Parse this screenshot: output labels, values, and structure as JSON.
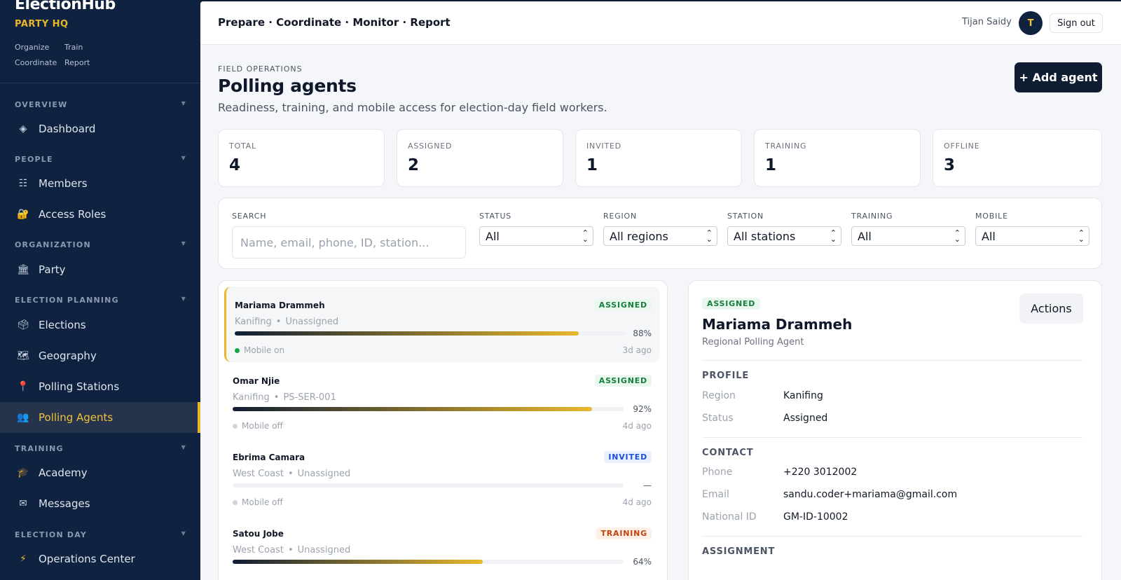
{
  "brand": {
    "name": "ElectionHub",
    "subtitle": "PARTY HQ",
    "tags": [
      "Organize",
      "Train",
      "Coordinate",
      "Report"
    ]
  },
  "sidebar": {
    "sections": [
      {
        "title": "OVERVIEW",
        "items": [
          {
            "label": "Dashboard",
            "icon": "diamond-icon"
          }
        ]
      },
      {
        "title": "PEOPLE",
        "items": [
          {
            "label": "Members",
            "icon": "list-icon"
          },
          {
            "label": "Access Roles",
            "icon": "lock-key-icon"
          }
        ]
      },
      {
        "title": "ORGANIZATION",
        "items": [
          {
            "label": "Party",
            "icon": "building-icon"
          }
        ]
      },
      {
        "title": "ELECTION PLANNING",
        "items": [
          {
            "label": "Elections",
            "icon": "ballot-box-icon"
          },
          {
            "label": "Geography",
            "icon": "map-icon"
          },
          {
            "label": "Polling Stations",
            "icon": "pin-icon"
          },
          {
            "label": "Polling Agents",
            "icon": "people-icon",
            "active": true
          }
        ]
      },
      {
        "title": "TRAINING",
        "items": [
          {
            "label": "Academy",
            "icon": "graduation-cap-icon"
          },
          {
            "label": "Messages",
            "icon": "envelope-icon"
          }
        ]
      },
      {
        "title": "ELECTION DAY",
        "items": [
          {
            "label": "Operations Center",
            "icon": "lightning-icon"
          }
        ]
      }
    ]
  },
  "topbar": {
    "tagline": "Prepare · Coordinate · Monitor · Report",
    "user_name": "Tijan Saidy",
    "avatar_initial": "T",
    "sign_out": "Sign out"
  },
  "page": {
    "eyebrow": "FIELD OPERATIONS",
    "title": "Polling agents",
    "subtitle": "Readiness, training, and mobile access for election-day field workers.",
    "add_button": "+ Add agent"
  },
  "stats": [
    {
      "label": "TOTAL",
      "value": "4"
    },
    {
      "label": "ASSIGNED",
      "value": "2"
    },
    {
      "label": "INVITED",
      "value": "1"
    },
    {
      "label": "TRAINING",
      "value": "1"
    },
    {
      "label": "OFFLINE",
      "value": "3"
    }
  ],
  "filters": {
    "search_label": "SEARCH",
    "search_placeholder": "Name, email, phone, ID, station...",
    "selects": [
      {
        "label": "STATUS",
        "value": "All"
      },
      {
        "label": "REGION",
        "value": "All regions"
      },
      {
        "label": "STATION",
        "value": "All stations"
      },
      {
        "label": "TRAINING",
        "value": "All"
      },
      {
        "label": "MOBILE",
        "value": "All"
      }
    ]
  },
  "agents": [
    {
      "name": "Mariama Drammeh",
      "status": "ASSIGNED",
      "region": "Kanifing",
      "station": "Unassigned",
      "progress": 88,
      "progress_label": "88%",
      "mobile": "Mobile on",
      "mobile_color": "#16a34a",
      "last_seen": "3d ago",
      "selected": true
    },
    {
      "name": "Omar Njie",
      "status": "ASSIGNED",
      "region": "Kanifing",
      "station": "PS-SER-001",
      "progress": 92,
      "progress_label": "92%",
      "mobile": "Mobile off",
      "mobile_color": "#cfd3da",
      "last_seen": "4d ago"
    },
    {
      "name": "Ebrima Camara",
      "status": "INVITED",
      "region": "West Coast",
      "station": "Unassigned",
      "progress": 0,
      "progress_label": "—",
      "mobile": "Mobile off",
      "mobile_color": "#cfd3da",
      "last_seen": "4d ago"
    },
    {
      "name": "Satou Jobe",
      "status": "TRAINING",
      "region": "West Coast",
      "station": "Unassigned",
      "progress": 64,
      "progress_label": "64%",
      "mobile": "Mobile off",
      "mobile_color": "#cfd3da",
      "last_seen": ""
    }
  ],
  "detail": {
    "status": "ASSIGNED",
    "name": "Mariama Drammeh",
    "role": "Regional Polling Agent",
    "actions": "Actions",
    "profile_title": "PROFILE",
    "profile": [
      {
        "key": "Region",
        "value": "Kanifing"
      },
      {
        "key": "Status",
        "value": "Assigned"
      }
    ],
    "contact_title": "CONTACT",
    "contact": [
      {
        "key": "Phone",
        "value": "+220 3012002"
      },
      {
        "key": "Email",
        "value": "sandu.coder+mariama@gmail.com"
      },
      {
        "key": "National ID",
        "value": "GM-ID-10002"
      }
    ],
    "assignment_title": "ASSIGNMENT"
  },
  "colors": {
    "sidebar_bg": "#0f2340",
    "accent": "#e8b72c",
    "assigned": "#15803d",
    "invited": "#1d4ed8",
    "training": "#c2410c"
  }
}
